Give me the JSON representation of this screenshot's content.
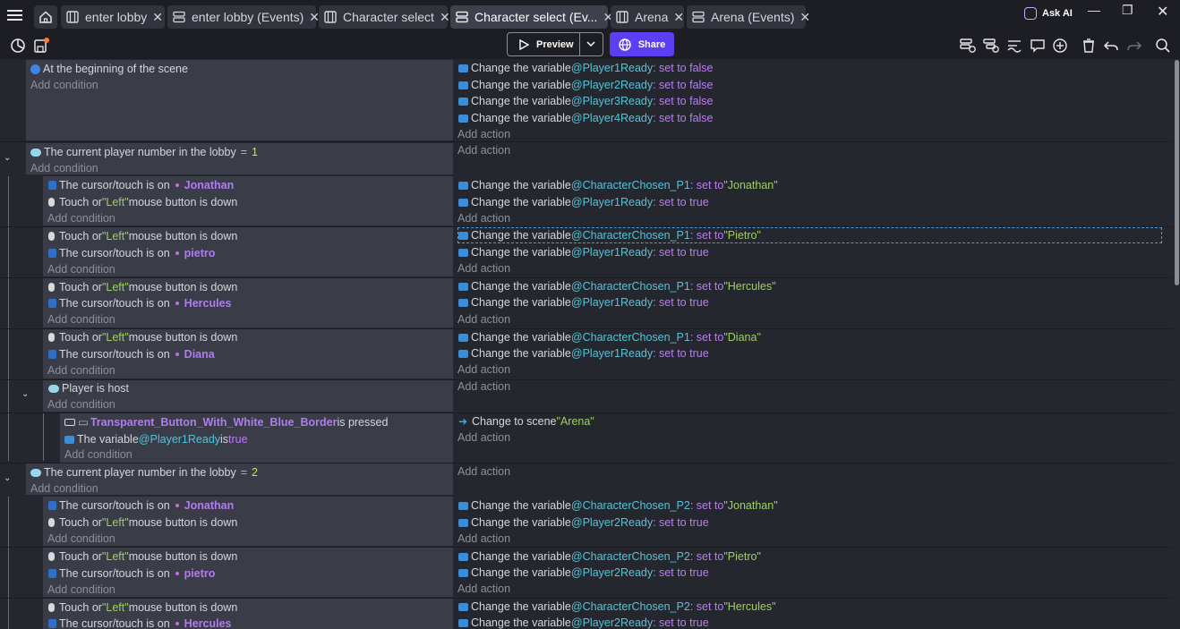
{
  "tabs": [
    {
      "label": "enter lobby",
      "icon": "scene-icon",
      "active": false
    },
    {
      "label": "enter lobby (Events)",
      "icon": "events-icon",
      "active": false
    },
    {
      "label": "Character select",
      "icon": "scene-icon",
      "active": false
    },
    {
      "label": "Character select (Ev...",
      "icon": "events-icon",
      "active": true
    },
    {
      "label": "Arena",
      "icon": "scene-icon",
      "active": false
    },
    {
      "label": "Arena (Events)",
      "icon": "events-icon",
      "active": false
    }
  ],
  "header": {
    "ask_ai": "Ask AI"
  },
  "toolbar": {
    "preview": "Preview",
    "share": "Share"
  },
  "events": {
    "e1": {
      "c1": "At the beginning of the scene",
      "add_condition": "Add condition",
      "a1": {
        "pre": "Change the variable ",
        "var": "Player1Ready",
        "mid": ": set to false"
      },
      "a2": {
        "pre": "Change the variable ",
        "var": "Player2Ready",
        "mid": ": set to false"
      },
      "a3": {
        "pre": "Change the variable ",
        "var": "Player3Ready",
        "mid": ": set to false"
      },
      "a4": {
        "pre": "Change the variable ",
        "var": "Player4Ready",
        "mid": ": set to false"
      },
      "add_action": "Add action"
    },
    "e2": {
      "c1": "The current player number in the lobby",
      "op": "=",
      "num": "1",
      "add_condition": "Add condition",
      "add_action": "Add action"
    },
    "s1": {
      "c1a": "The cursor/touch is on",
      "c1b": "Jonathan",
      "c2a": "Touch or ",
      "c2b": "\"Left\"",
      "c2c": " mouse button is down",
      "add_condition": "Add condition",
      "a1": {
        "pre": "Change the variable ",
        "var": "CharacterChosen_P1",
        "set": ": set to ",
        "val": "\"Jonathan\""
      },
      "a2": {
        "pre": "Change the variable ",
        "var": "Player1Ready",
        "set": ": set to true"
      },
      "add_action": "Add action"
    },
    "s2": {
      "c1a": "Touch or ",
      "c1b": "\"Left\"",
      "c1c": " mouse button is down",
      "c2a": "The cursor/touch is on",
      "c2b": "pietro",
      "add_condition": "Add condition",
      "a1": {
        "pre": "Change the variable ",
        "var": "CharacterChosen_P1",
        "set": ": set to ",
        "val": "\"Pietro\""
      },
      "a2": {
        "pre": "Change the variable ",
        "var": "Player1Ready",
        "set": ": set to true"
      },
      "add_action": "Add action"
    },
    "s3": {
      "c1a": "Touch or ",
      "c1b": "\"Left\"",
      "c1c": " mouse button is down",
      "c2a": "The cursor/touch is on",
      "c2b": "Hercules",
      "add_condition": "Add condition",
      "a1": {
        "pre": "Change the variable ",
        "var": "CharacterChosen_P1",
        "set": ": set to ",
        "val": "\"Hercules\""
      },
      "a2": {
        "pre": "Change the variable ",
        "var": "Player1Ready",
        "set": ": set to true"
      },
      "add_action": "Add action"
    },
    "s4": {
      "c1a": "Touch or ",
      "c1b": "\"Left\"",
      "c1c": " mouse button is down",
      "c2a": "The cursor/touch is on",
      "c2b": "Diana",
      "add_condition": "Add condition",
      "a1": {
        "pre": "Change the variable ",
        "var": "CharacterChosen_P1",
        "set": ": set to ",
        "val": "\"Diana\""
      },
      "a2": {
        "pre": "Change the variable ",
        "var": "Player1Ready",
        "set": ": set to true"
      },
      "add_action": "Add action"
    },
    "s5": {
      "c1": "Player is host",
      "add_condition": "Add condition",
      "add_action": "Add action"
    },
    "s6": {
      "c1a": "Transparent_Button_With_White_Blue_Border",
      "c1b": " is pressed",
      "c2a": "The variable ",
      "c2b": "Player1Ready",
      "c2c": " is ",
      "c2d": "true",
      "add_condition": "Add condition",
      "a1a": "Change to scene ",
      "a1b": "\"Arena\"",
      "add_action": "Add action"
    },
    "e3": {
      "c1": "The current player number in the lobby",
      "op": "=",
      "num": "2",
      "add_condition": "Add condition",
      "add_action": "Add action"
    },
    "t1": {
      "c1a": "The cursor/touch is on",
      "c1b": "Jonathan",
      "c2a": "Touch or ",
      "c2b": "\"Left\"",
      "c2c": " mouse button is down",
      "add_condition": "Add condition",
      "a1": {
        "pre": "Change the variable ",
        "var": "CharacterChosen_P2",
        "set": ": set to ",
        "val": "\"Jonathan\""
      },
      "a2": {
        "pre": "Change the variable ",
        "var": "Player2Ready",
        "set": ": set to true"
      },
      "add_action": "Add action"
    },
    "t2": {
      "c1a": "Touch or ",
      "c1b": "\"Left\"",
      "c1c": " mouse button is down",
      "c2a": "The cursor/touch is on",
      "c2b": "pietro",
      "add_condition": "Add condition",
      "a1": {
        "pre": "Change the variable ",
        "var": "CharacterChosen_P2",
        "set": ": set to ",
        "val": "\"Pietro\""
      },
      "a2": {
        "pre": "Change the variable ",
        "var": "Player2Ready",
        "set": ": set to true"
      },
      "add_action": "Add action"
    },
    "t3": {
      "c1a": "Touch or ",
      "c1b": "\"Left\"",
      "c1c": " mouse button is down",
      "c2a": "The cursor/touch is on",
      "c2b": "Hercules",
      "a1": {
        "pre": "Change the variable ",
        "var": "CharacterChosen_P2",
        "set": ": set to ",
        "val": "\"Hercules\""
      },
      "a2": {
        "pre": "Change the variable ",
        "var": "Player2Ready",
        "set": ": set to true"
      }
    }
  }
}
